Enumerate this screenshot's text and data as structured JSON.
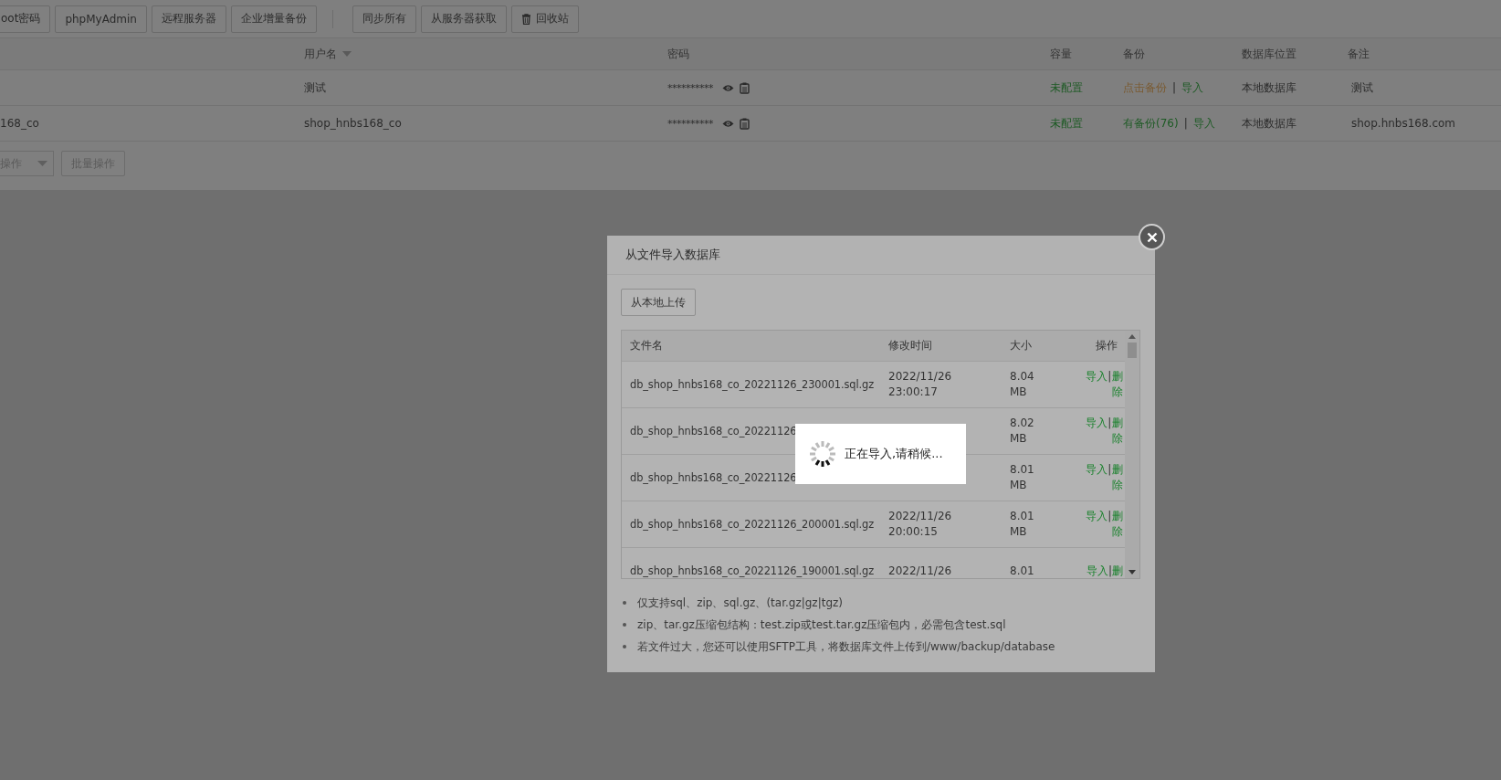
{
  "toolbar": {
    "groups": [
      [
        {
          "label": "oot密码",
          "kind": "text"
        },
        {
          "label": "phpMyAdmin",
          "kind": "text"
        },
        {
          "label": "远程服务器",
          "kind": "text"
        },
        {
          "label": "企业增量备份",
          "kind": "text"
        }
      ],
      [
        {
          "label": "同步所有",
          "kind": "text"
        },
        {
          "label": "从服务器获取",
          "kind": "text"
        },
        {
          "label": "回收站",
          "kind": "trash"
        }
      ]
    ]
  },
  "table": {
    "columns": [
      {
        "label": "用户名",
        "sortable": true
      },
      {
        "label": "密码",
        "sortable": false
      },
      {
        "label": "容量",
        "sortable": false
      },
      {
        "label": "备份",
        "sortable": false
      },
      {
        "label": "数据库位置",
        "sortable": false
      },
      {
        "label": "备注",
        "sortable": false
      }
    ],
    "rows": [
      {
        "username": "测试",
        "password": "**********",
        "capacity": "未配置",
        "backup": {
          "label": "点击备份",
          "kind": "none"
        },
        "separator": "|",
        "import": "导入",
        "location": "本地数据库",
        "note": "测试"
      },
      {
        "column_1": "168_co",
        "username": "shop_hnbs168_co",
        "password": "**********",
        "capacity": "未配置",
        "backup": {
          "label": "有备份(76)",
          "kind": "exists"
        },
        "separator": "|",
        "import": "导入",
        "location": "本地数据库",
        "note": "shop.hnbs168.com"
      }
    ]
  },
  "bulk": {
    "select": {
      "label": "操作",
      "disabled": true
    },
    "button": {
      "label": "批量操作",
      "disabled": true
    }
  },
  "modal": {
    "title": "从文件导入数据库",
    "upload_button": "从本地上传",
    "columns": [
      "文件名",
      "修改时间",
      "大小",
      "操作"
    ],
    "files": [
      {
        "name": "db_shop_hnbs168_co_20221126_230001.sql.gz",
        "time": [
          "2022/11/26",
          "23:00:17"
        ],
        "size": [
          "8.04",
          "MB"
        ],
        "actions": [
          "导入",
          "|",
          "删除"
        ]
      },
      {
        "name": "db_shop_hnbs168_co_20221126",
        "size": [
          "8.02",
          "MB"
        ],
        "actions": [
          "导入",
          "|",
          "删除"
        ]
      },
      {
        "name": "db_shop_hnbs168_co_20221126",
        "size": [
          "8.01",
          "MB"
        ],
        "actions": [
          "导入",
          "|",
          "删除"
        ]
      },
      {
        "name": "db_shop_hnbs168_co_20221126_200001.sql.gz",
        "time": [
          "2022/11/26",
          "20:00:15"
        ],
        "size": [
          "8.01",
          "MB"
        ],
        "actions": [
          "导入",
          "|",
          "删除"
        ]
      },
      {
        "name": "db_shop_hnbs168_co_20221126_190001.sql.gz",
        "time": [
          "2022/11/26"
        ],
        "size": [
          "8.01"
        ],
        "actions": [
          "导入",
          "|",
          "删"
        ]
      }
    ],
    "notes": [
      "仅支持sql、zip、sql.gz、(tar.gz|gz|tgz)",
      "zip、tar.gz压缩包结构：test.zip或test.tar.gz压缩包内，必需包含test.sql",
      "若文件过大，您还可以使用SFTP工具，将数据库文件上传到/www/backup/database"
    ],
    "loading": {
      "text": "正在导入,请稍候..."
    }
  }
}
